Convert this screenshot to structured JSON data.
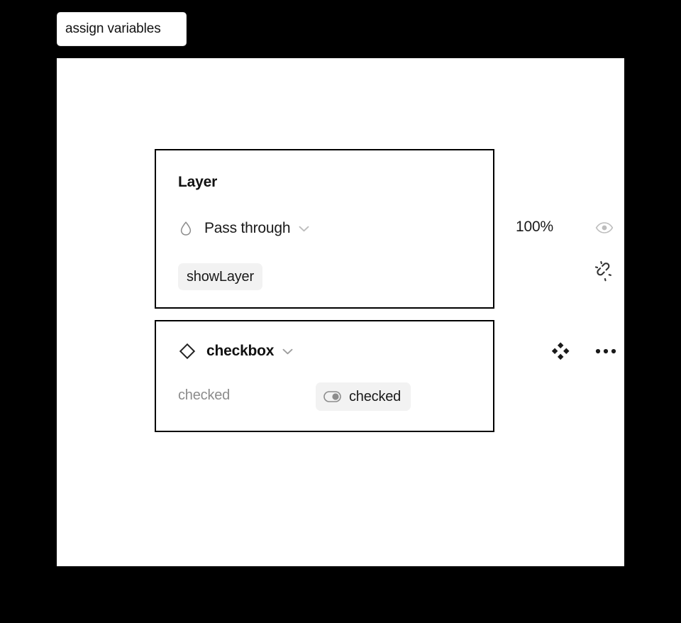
{
  "tooltip": {
    "text": "assign variables"
  },
  "canvas": {
    "background_color": "#ffffff",
    "outer_background_color": "#000000"
  },
  "layer_panel": {
    "title": "Layer",
    "blend_mode": {
      "icon": "blend-drop-icon",
      "label": "Pass through",
      "chevron_icon": "chevron-down-icon"
    },
    "opacity": "100%",
    "visibility_icon": "eye-icon",
    "variable_chip": {
      "label": "showLayer",
      "background_color": "#f2f2f2"
    },
    "detach_icon": "broken-link-icon"
  },
  "component_panel": {
    "instance": {
      "icon": "component-diamond-icon",
      "name": "checkbox",
      "chevron_icon": "chevron-down-icon"
    },
    "swap_icon": "swap-instance-icon",
    "more_icon": "more-options-icon",
    "properties": [
      {
        "label": "checked",
        "value": "checked",
        "value_icon": "boolean-toggle-icon",
        "value_background_color": "#f2f2f2"
      }
    ]
  }
}
